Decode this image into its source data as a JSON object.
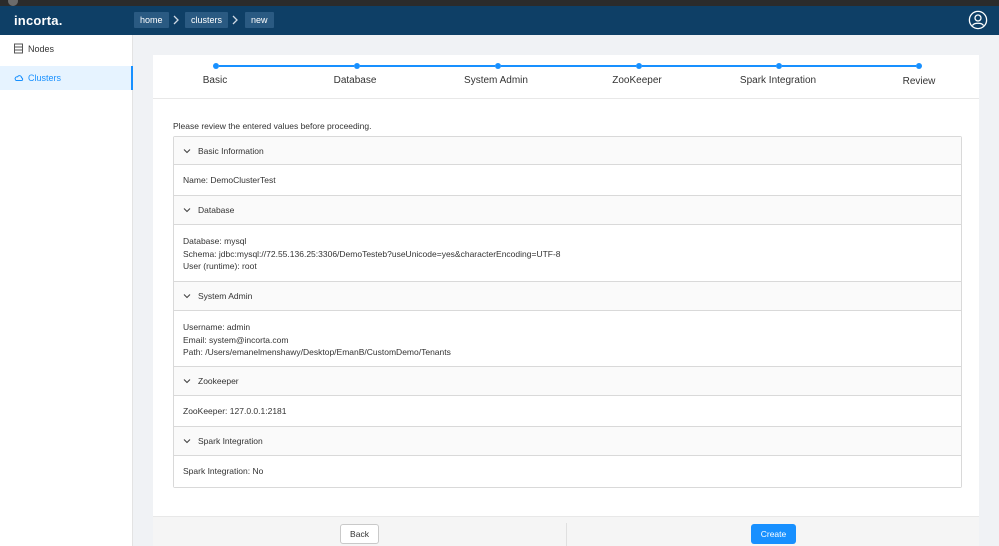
{
  "header": {
    "logo": "incorta.",
    "breadcrumb": [
      "home",
      "clusters",
      "new"
    ]
  },
  "sidebar": {
    "items": [
      {
        "label": "Nodes",
        "icon": "server-icon",
        "active": false
      },
      {
        "label": "Clusters",
        "icon": "cloud-icon",
        "active": true
      }
    ]
  },
  "steps": {
    "items": [
      "Basic",
      "Database",
      "System Admin",
      "ZooKeeper",
      "Spark Integration",
      "Review"
    ],
    "current": "Review"
  },
  "review": {
    "intro": "Please review the entered values before proceeding.",
    "sections": [
      {
        "title": "Basic Information",
        "lines": [
          "Name: DemoClusterTest"
        ]
      },
      {
        "title": "Database",
        "lines": [
          "Database: mysql",
          "Schema: jdbc:mysql://72.55.136.25:3306/DemoTesteb?useUnicode=yes&characterEncoding=UTF-8",
          "User (runtime): root"
        ]
      },
      {
        "title": "System Admin",
        "lines": [
          "Username: admin",
          "Email: system@incorta.com",
          "Path: /Users/emanelmenshawy/Desktop/EmanB/CustomDemo/Tenants"
        ]
      },
      {
        "title": "Zookeeper",
        "lines": [
          "ZooKeeper: 127.0.0.1:2181"
        ]
      },
      {
        "title": "Spark Integration",
        "lines": [
          "Spark Integration: No"
        ]
      }
    ]
  },
  "footer": {
    "back_label": "Back",
    "create_label": "Create"
  },
  "colors": {
    "header": "#0e3f66",
    "accent": "#1890ff"
  }
}
